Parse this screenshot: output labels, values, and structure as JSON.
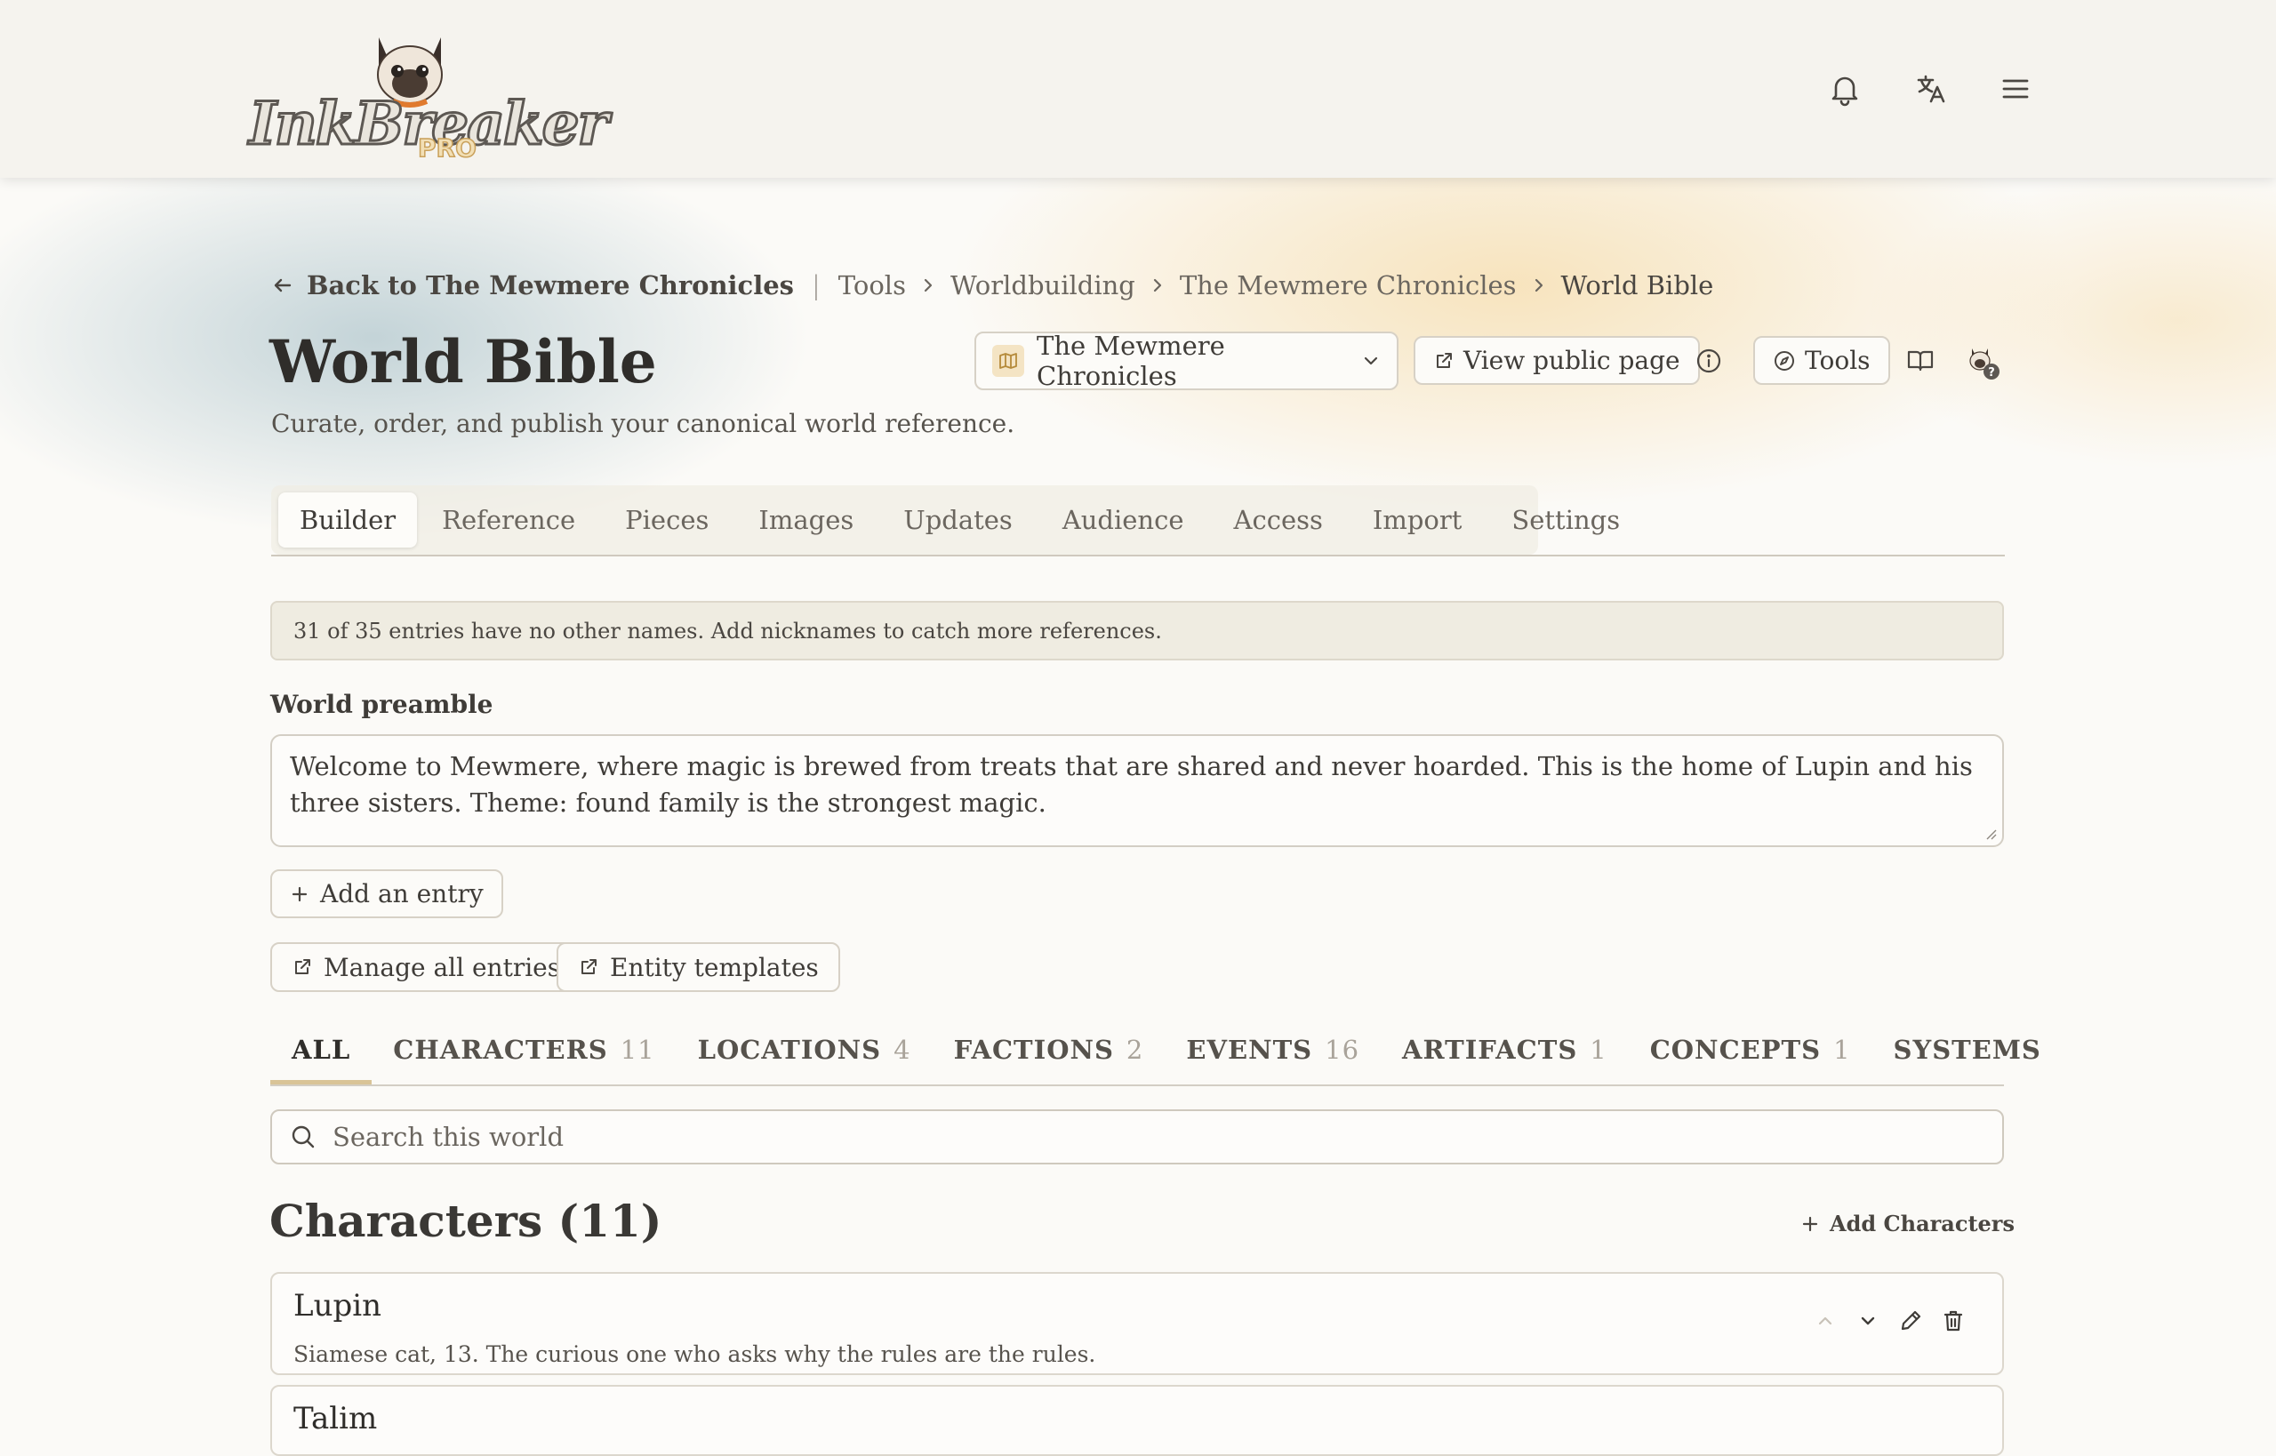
{
  "brand": {
    "logo_text": "InkBreaker",
    "logo_badge": "PRO"
  },
  "breadcrumb": {
    "back": "Back to The Mewmere Chronicles",
    "items": [
      "Tools",
      "Worldbuilding",
      "The Mewmere Chronicles"
    ],
    "current": "World Bible"
  },
  "page": {
    "title": "World Bible",
    "subtitle": "Curate, order, and publish your canonical world reference."
  },
  "toolbar": {
    "world_select": "The Mewmere Chronicles",
    "view_public": "View public page",
    "tools": "Tools"
  },
  "tabs": [
    "Builder",
    "Reference",
    "Pieces",
    "Images",
    "Updates",
    "Audience",
    "Access",
    "Import",
    "Settings"
  ],
  "active_tab": "Builder",
  "notice": "31 of 35 entries have no other names. Add nicknames to catch more references.",
  "preamble": {
    "label": "World preamble",
    "value": "Welcome to Mewmere, where magic is brewed from treats that are shared and never hoarded. This is the home of Lupin and his three sisters. Theme: found family is the strongest magic."
  },
  "actions": {
    "add_entry": "Add an entry",
    "manage_entries": "Manage all entries",
    "entity_templates": "Entity templates"
  },
  "categories": [
    {
      "label": "ALL",
      "count": ""
    },
    {
      "label": "CHARACTERS",
      "count": "11"
    },
    {
      "label": "LOCATIONS",
      "count": "4"
    },
    {
      "label": "FACTIONS",
      "count": "2"
    },
    {
      "label": "EVENTS",
      "count": "16"
    },
    {
      "label": "ARTIFACTS",
      "count": "1"
    },
    {
      "label": "CONCEPTS",
      "count": "1"
    },
    {
      "label": "SYSTEMS",
      "count": ""
    }
  ],
  "search": {
    "placeholder": "Search this world"
  },
  "section": {
    "title": "Characters (11)",
    "add_label": "Add Characters"
  },
  "entries": [
    {
      "name": "Lupin",
      "desc": "Siamese cat, 13. The curious one who asks why the rules are the rules."
    },
    {
      "name": "Talim",
      "desc": ""
    }
  ],
  "colors": {
    "accent": "#d9c497",
    "background": "#fbfaf7",
    "header": "#f5f3ee"
  }
}
